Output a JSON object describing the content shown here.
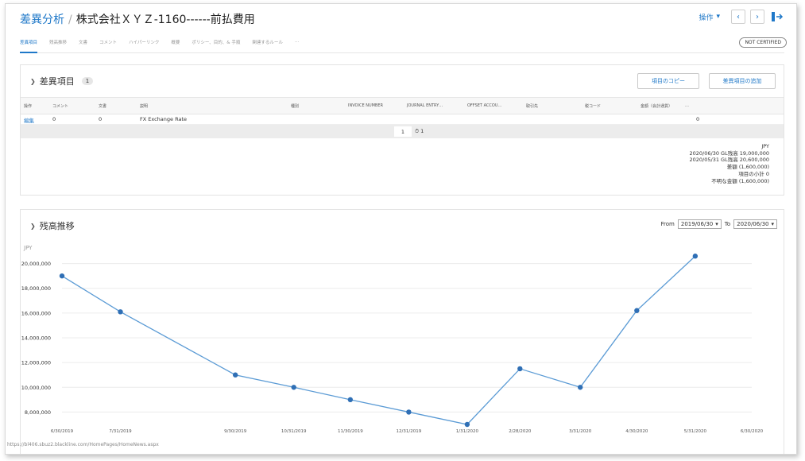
{
  "header": {
    "breadcrumb": "差異分析",
    "title": "株式会社ＸＹＺ-1160------前払費用",
    "ops_label": "操作"
  },
  "tabs": [
    {
      "label": "差異項目",
      "active": true
    },
    {
      "label": "残高推移"
    },
    {
      "label": "文書"
    },
    {
      "label": "コメント"
    },
    {
      "label": "ハイパーリンク"
    },
    {
      "label": "概要"
    },
    {
      "label": "ポリシー、目的、& 手順"
    },
    {
      "label": "関連するルール"
    },
    {
      "label": "…"
    }
  ],
  "cert_badge": "NOT CERTIFIED",
  "variance": {
    "title": "差異項目",
    "count": "1",
    "copy_button": "項目のコピー",
    "add_button": "差異項目の追加",
    "columns": [
      "操作",
      "コメント",
      "文書",
      "説明",
      "種別",
      "INVOICE NUMBER",
      "JOURNAL ENTRY…",
      "OFFSET ACCOU…",
      "取引先",
      "税コード",
      "金額（会計通貨）",
      "…"
    ],
    "row": {
      "action": "編集",
      "comments": "0",
      "docs": "0",
      "description": "FX Exchange Rate",
      "amount": "0"
    },
    "pager": {
      "page": "1",
      "count": "1"
    },
    "summary": [
      "JPY",
      "2020/06/30 GL残高   19,000,000",
      "2020/05/31 GL残高   20,600,000",
      "差額   (1,600,000)",
      "項目の小計   0",
      "不明な金額   (1,600,000)"
    ]
  },
  "trend": {
    "title": "残高推移",
    "from_label": "From",
    "from_value": "2019/06/30",
    "to_label": "To",
    "to_value": "2020/06/30"
  },
  "status_url": "https://bl406.sbuz2.blackline.com/HomePages/HomeNews.aspx",
  "chart_data": {
    "type": "line",
    "ylabel": "JPY",
    "y_ticks": [
      "20,000,000",
      "18,000,000",
      "16,000,000",
      "14,000,000",
      "12,000,000",
      "10,000,000",
      "8,000,000"
    ],
    "ylim": [
      7000000,
      21000000
    ],
    "x_ticks": [
      "6/30/2019",
      "7/31/2019",
      "9/30/2019",
      "10/31/2019",
      "11/30/2019",
      "12/31/2019",
      "1/31/2020",
      "2/28/2020",
      "3/31/2020",
      "4/30/2020",
      "5/31/2020",
      "6/30/2020"
    ],
    "x_range": [
      "2019-06-30",
      "2020-06-30"
    ],
    "series": [
      {
        "color": "#5b9bd5",
        "points": [
          {
            "x": "2019-06-30",
            "y": 19000000
          },
          {
            "x": "2019-07-31",
            "y": 16100000
          },
          {
            "x": "2019-09-30",
            "y": 11000000
          },
          {
            "x": "2019-10-31",
            "y": 10000000
          },
          {
            "x": "2019-11-30",
            "y": 9000000
          },
          {
            "x": "2019-12-31",
            "y": 8000000
          },
          {
            "x": "2020-01-31",
            "y": 7000000
          },
          {
            "x": "2020-02-28",
            "y": 11500000
          },
          {
            "x": "2020-03-31",
            "y": 10000000
          },
          {
            "x": "2020-04-30",
            "y": 16200000
          },
          {
            "x": "2020-05-31",
            "y": 20600000
          }
        ]
      }
    ],
    "grid": true
  }
}
